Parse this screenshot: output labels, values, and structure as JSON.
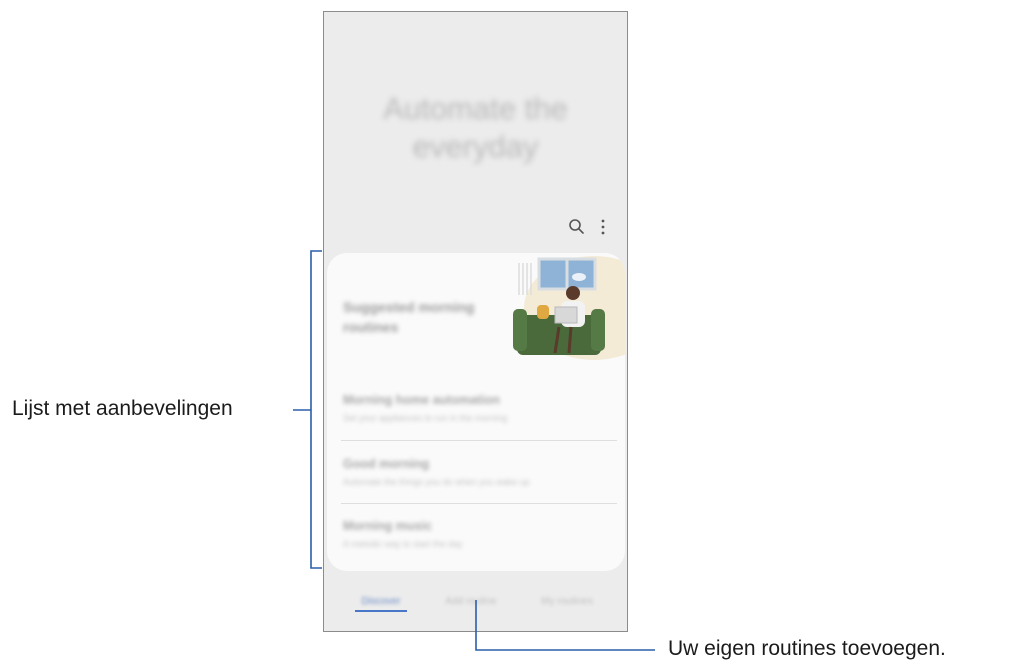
{
  "screen": {
    "hero_title_line1": "Automate the",
    "hero_title_line2": "everyday",
    "toolbar": {
      "search_icon": "search-icon",
      "more_icon": "more-vertical-icon"
    },
    "card": {
      "title": "Suggested morning routines",
      "items": [
        {
          "title": "Morning home automation",
          "subtitle": "Set your appliances to run in the morning"
        },
        {
          "title": "Good morning",
          "subtitle": "Automate the things you do when you wake up"
        },
        {
          "title": "Morning music",
          "subtitle": "A melodic way to start the day"
        }
      ]
    },
    "tabs": [
      {
        "label": "Discover",
        "active": true
      },
      {
        "label": "Add routine",
        "active": false
      },
      {
        "label": "My routines",
        "active": false
      }
    ]
  },
  "callouts": {
    "recommendations_list": "Lijst met aanbevelingen",
    "add_own_routines": "Uw eigen routines toevoegen."
  },
  "colors": {
    "callout_line": "#2a5fa8",
    "tab_active": "#4a78c8",
    "illustration_sofa": "#4a6a3c"
  }
}
